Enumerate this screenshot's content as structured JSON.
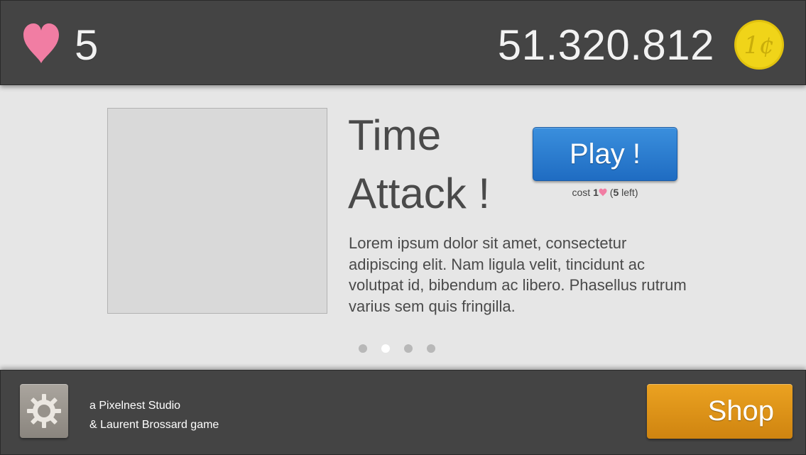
{
  "header": {
    "lives": "5",
    "coins": "51.320.812",
    "heart_icon": "heart-icon",
    "coin_icon": "coin-icon",
    "heart_color": "#f17da3",
    "coin_color": "#f0d419"
  },
  "game": {
    "title": "Time Attack !",
    "play_label": "Play !",
    "cost_prefix": "cost ",
    "cost_amount": "1",
    "cost_open": " (",
    "lives_left": "5",
    "cost_suffix": " left)",
    "description": "Lorem ipsum dolor sit amet, consectetur adipiscing elit. Nam ligula velit, tincidunt ac volutpat id, bibendum ac libero. Phasellus rutrum varius sem quis fringilla.",
    "play_color": "#2a7ad0"
  },
  "pager": {
    "count": 4,
    "active_index": 1
  },
  "footer": {
    "settings_icon": "gear-icon",
    "credits_line1": "a Pixelnest Studio",
    "credits_line2": "& Laurent Brossard game",
    "shop_label": "Shop",
    "shop_color": "#e0961a"
  }
}
